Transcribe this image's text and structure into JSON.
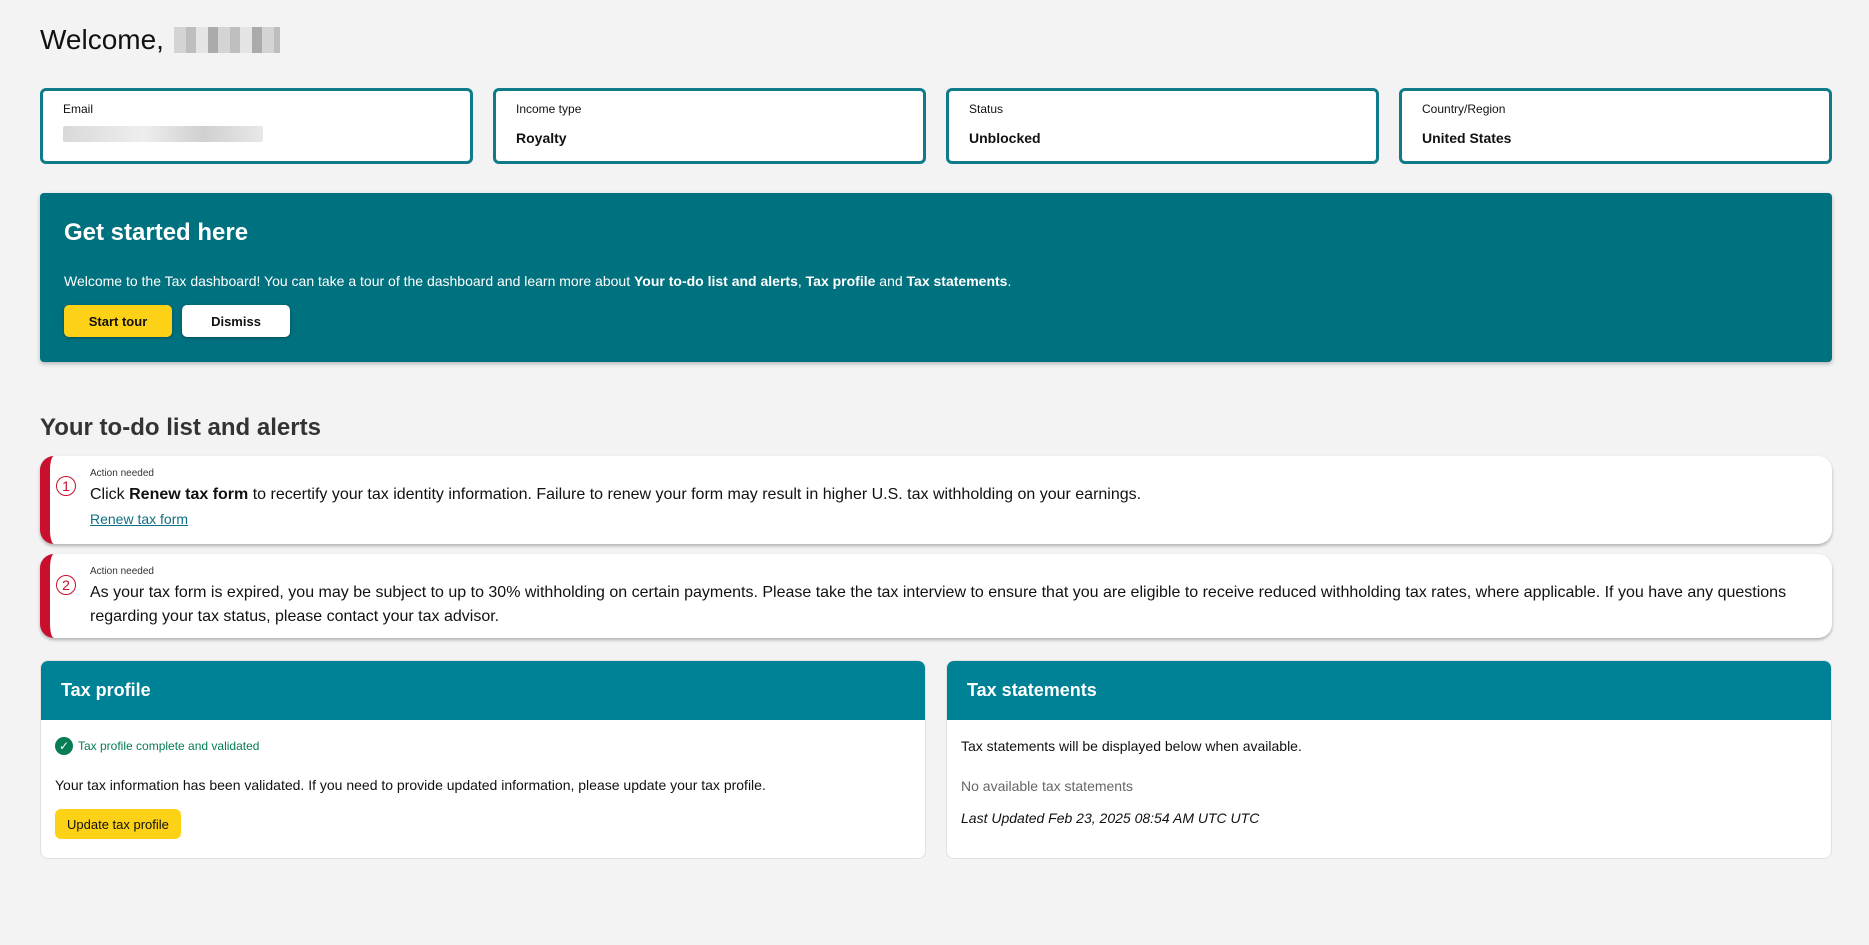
{
  "welcome": {
    "greeting": "Welcome,"
  },
  "cards": [
    {
      "label": "Email",
      "value": ""
    },
    {
      "label": "Income type",
      "value": "Royalty"
    },
    {
      "label": "Status",
      "value": "Unblocked"
    },
    {
      "label": "Country/Region",
      "value": "United States"
    }
  ],
  "banner": {
    "title": "Get started here",
    "text_pre": "Welcome to the Tax dashboard! You can take a tour of the dashboard and learn more about ",
    "link1": "Your to-do list and alerts",
    "sep1": ", ",
    "link2": "Tax profile",
    "sep2": " and ",
    "link3": "Tax statements",
    "end": ".",
    "start_label": "Start tour",
    "dismiss_label": "Dismiss"
  },
  "todo": {
    "title": "Your to-do list and alerts",
    "alerts": [
      {
        "number": "1",
        "tag": "Action needed",
        "msg_pre": "Click ",
        "msg_bold": "Renew tax form",
        "msg_post": " to recertify your tax identity information. Failure to renew your form may result in higher U.S. tax withholding on your earnings.",
        "link": "Renew tax form"
      },
      {
        "number": "2",
        "tag": "Action needed",
        "msg": "As your tax form is expired, you may be subject to up to 30% withholding on certain payments. Please take the tax interview to ensure that you are eligible to receive reduced withholding tax rates, where applicable. If you have any questions regarding your tax status, please contact your tax advisor."
      }
    ]
  },
  "tax_profile": {
    "title": "Tax profile",
    "status_icon": "check-circle-icon",
    "status": "Tax profile complete and validated",
    "text": "Your tax information has been validated. If you need to provide updated information, please update your tax profile.",
    "button": "Update tax profile"
  },
  "tax_statements": {
    "title": "Tax statements",
    "info": "Tax statements will be displayed below when available.",
    "empty": "No available tax statements",
    "updated": "Last Updated Feb 23, 2025 08:54 AM UTC UTC"
  },
  "colors": {
    "accent_teal": "#00717f",
    "panel_header": "#008296",
    "alert_red": "#c8102e",
    "button_yellow": "#fcd116",
    "success_green": "#067d52"
  }
}
